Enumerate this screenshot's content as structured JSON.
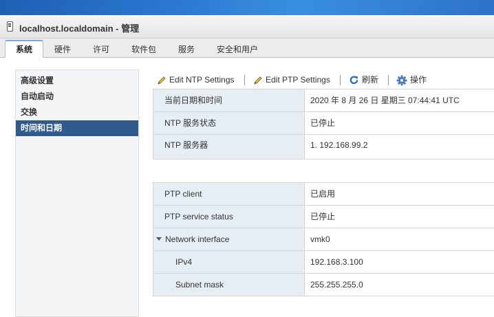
{
  "window": {
    "title": "localhost.localdomain - 管理"
  },
  "tabs": [
    {
      "label": "系统",
      "active": true
    },
    {
      "label": "硬件"
    },
    {
      "label": "许可"
    },
    {
      "label": "软件包"
    },
    {
      "label": "服务"
    },
    {
      "label": "安全和用户"
    }
  ],
  "sidebar": {
    "items": [
      {
        "label": "高级设置"
      },
      {
        "label": "自动启动"
      },
      {
        "label": "交换"
      },
      {
        "label": "时间和日期",
        "selected": true
      }
    ]
  },
  "toolbar": {
    "edit_ntp": "Edit NTP Settings",
    "edit_ptp": "Edit PTP Settings",
    "refresh": "刷新",
    "actions": "操作"
  },
  "ntp_table": [
    {
      "label": "当前日期和时间",
      "value": "2020 年 8 月 26 日 星期三 07:44:41 UTC"
    },
    {
      "label": "NTP 服务状态",
      "value": "已停止"
    },
    {
      "label": "NTP 服务器",
      "value": "1. 192.168.99.2"
    }
  ],
  "ptp_table": [
    {
      "label": "PTP client",
      "value": "已启用"
    },
    {
      "label": "PTP service status",
      "value": "已停止"
    },
    {
      "label": "Network interface",
      "value": "vmk0"
    },
    {
      "label": "IPv4",
      "value": "192.168.3.100"
    },
    {
      "label": "Subnet mask",
      "value": "255.255.255.0"
    }
  ],
  "colors": {
    "accent": "#2f5b8f",
    "label_bg": "#e6eef4",
    "refresh_icon": "#1e6fc2",
    "edit_icon": "#c9a227"
  }
}
